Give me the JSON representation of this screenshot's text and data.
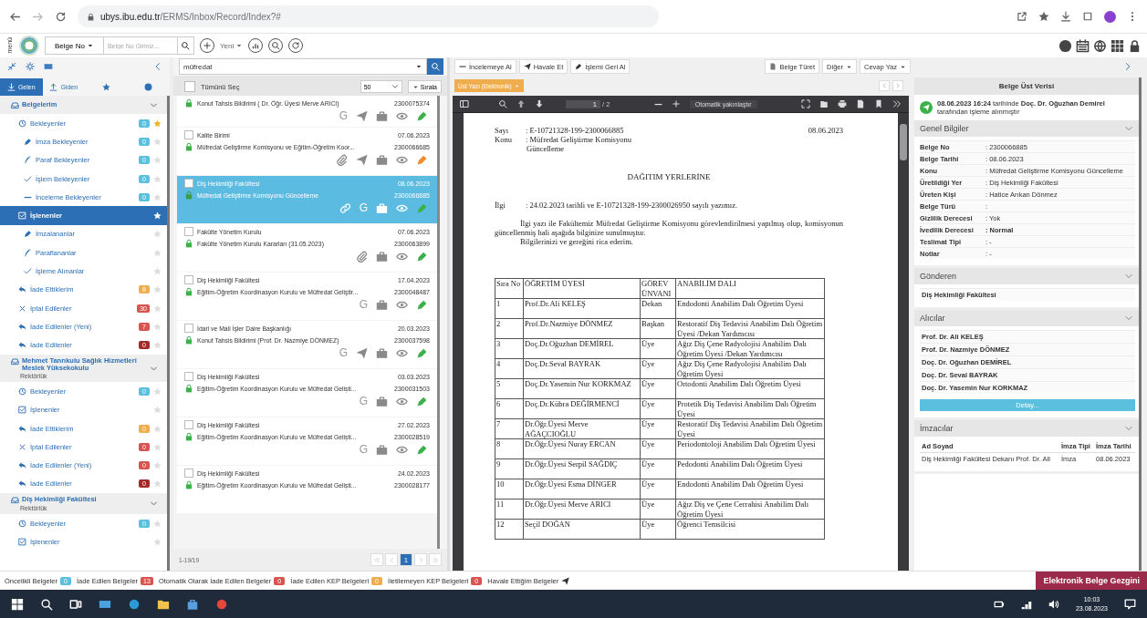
{
  "browser": {
    "host": "ubys.ibu.edu.tr",
    "path": "/ERMS/Inbox/Record/Index?#"
  },
  "toolbar": {
    "menu_label": "menü",
    "search_type": "Belge No",
    "search_placeholder": "Belge No Giriniz...",
    "new_label": "Yeni"
  },
  "sidebar": {
    "tabs": [
      {
        "kind": "incoming",
        "label": "Gelen",
        "selected": true
      },
      {
        "kind": "outgoing",
        "label": "Giden",
        "selected": false
      },
      {
        "kind": "favorites",
        "selected": false
      },
      {
        "kind": "info",
        "selected": false
      }
    ],
    "sections": [
      {
        "title": "Belgelerim",
        "items": [
          {
            "kind": "waiting",
            "label": "Bekleyenler",
            "count": "0",
            "color": "#5bc0de",
            "starred": true,
            "selected": false,
            "children": [
              {
                "kind": "sign",
                "label": "İmza Bekleyenler",
                "count": "0",
                "color": "#5bc0de",
                "starred": false,
                "selected": false
              },
              {
                "kind": "initial",
                "label": "Paraf Bekleyenler",
                "count": "0",
                "color": "#5bc0de",
                "starred": false,
                "selected": false
              },
              {
                "kind": "process",
                "label": "İşlem Bekleyenler",
                "count": "0",
                "color": "#5bc0de",
                "starred": false,
                "selected": false
              },
              {
                "kind": "review",
                "label": "İnceleme Bekleyenler",
                "count": "0",
                "color": "#5bc0de",
                "starred": false,
                "selected": false
              }
            ]
          },
          {
            "kind": "processed",
            "label": "İşlenenler",
            "starred": false,
            "selected": true,
            "children": [
              {
                "kind": "sign",
                "label": "İmzalananlar",
                "starred": false,
                "selected": false
              },
              {
                "kind": "initial",
                "label": "Paraflananlar",
                "starred": false,
                "selected": false
              },
              {
                "kind": "process",
                "label": "İşleme Alınanlar",
                "starred": false,
                "selected": false
              }
            ]
          },
          {
            "kind": "returned",
            "label": "İade Ettiklerim",
            "count": "8",
            "color": "#f0ad4e",
            "starred": false,
            "selected": false
          },
          {
            "kind": "cancelled",
            "label": "İptal Edilenler",
            "count": "30",
            "color": "#d9534f",
            "starred": false,
            "selected": false
          },
          {
            "kind": "returned",
            "label": "İade Edilenler (Yeni)",
            "count": "7",
            "color": "#d9534f",
            "starred": false,
            "selected": false
          },
          {
            "kind": "returned",
            "label": "İade Edilenler",
            "count": "0",
            "color": "#a52a2a",
            "starred": false,
            "selected": false
          }
        ]
      },
      {
        "title": "Mehmet Tanrıkulu Sağlık Hizmetleri Meslek Yüksekokulu",
        "subtitle": "Rektörlük",
        "items": [
          {
            "kind": "waiting",
            "label": "Bekleyenler",
            "count": "0",
            "color": "#5bc0de",
            "starred": false,
            "selected": false
          },
          {
            "kind": "processed",
            "label": "İşlenenler",
            "starred": false,
            "selected": false
          },
          {
            "kind": "returned",
            "label": "İade Ettiklerim",
            "count": "0",
            "color": "#f0ad4e",
            "starred": false,
            "selected": false
          },
          {
            "kind": "cancelled",
            "label": "İptal Edilenler",
            "count": "0",
            "color": "#d9534f",
            "starred": false,
            "selected": false
          },
          {
            "kind": "returned",
            "label": "İade Edilenler (Yeni)",
            "count": "0",
            "color": "#d9534f",
            "starred": false,
            "selected": false
          },
          {
            "kind": "returned",
            "label": "İade Edilenler",
            "count": "0",
            "color": "#a52a2a",
            "starred": false,
            "selected": false
          }
        ]
      },
      {
        "title": "Diş Hekimliği Fakültesi",
        "subtitle": "Rektörlük",
        "items": [
          {
            "kind": "waiting",
            "label": "Bekleyenler",
            "count": "0",
            "color": "#5bc0de",
            "starred": false,
            "selected": false
          },
          {
            "kind": "processed",
            "label": "İşlenenler",
            "starred": false,
            "selected": false
          }
        ]
      }
    ]
  },
  "list": {
    "search_value": "müfredat",
    "select_all": "Tümünü Seç",
    "select_all_checked": false,
    "page_size": "50",
    "sort_label": "Sırala",
    "rows": [
      {
        "subject": "Konut Tahsis Bildirimi ( Dr. Öğr. Üyesi Merve ARICI)",
        "number": "2300075374",
        "selected": false,
        "actions": [
          {
            "kind": "letter",
            "text": "G"
          },
          {
            "kind": "send"
          },
          {
            "kind": "archive"
          },
          {
            "kind": "view"
          },
          {
            "kind": "sign",
            "color": "#3cb04a"
          }
        ]
      },
      {
        "sender": "Kalite Birimi",
        "date": "07.06.2023",
        "subject": "Müfredat Geliştirme Komisyonu ve Eğitim-Öğretim Koor...",
        "number": "2300066685",
        "selected": false,
        "actions": [
          {
            "kind": "attachment"
          },
          {
            "kind": "send"
          },
          {
            "kind": "archive"
          },
          {
            "kind": "view"
          },
          {
            "kind": "sign",
            "color": "#f08c2e"
          }
        ]
      },
      {
        "sender": "Diş Hekimliği Fakültesi",
        "date": "08.06.2023",
        "subject": "Müfredat Geliştirme Komisyonu Güncelleme",
        "number": "2300066885",
        "selected": true,
        "actions": [
          {
            "kind": "link"
          },
          {
            "kind": "letter",
            "text": "G"
          },
          {
            "kind": "archive"
          },
          {
            "kind": "view"
          },
          {
            "kind": "sign",
            "color": "#3cb04a"
          }
        ]
      },
      {
        "sender": "Fakülte Yönetim Kurulu",
        "date": "07.06.2023",
        "subject": "Fakülte Yönetim Kurulu Kararları (31.05.2023)",
        "number": "2300063899",
        "selected": false,
        "actions": [
          {
            "kind": "attachment"
          },
          {
            "kind": "archive"
          },
          {
            "kind": "view"
          },
          {
            "kind": "sign",
            "color": "#3cb04a"
          }
        ]
      },
      {
        "sender": "Diş Hekimliği Fakültesi",
        "date": "17.04.2023",
        "subject": "Eğitim-Öğretim Koordinasyon Kurulu ve Müfredat Geliştir...",
        "number": "2300048487",
        "selected": false,
        "actions": [
          {
            "kind": "letter",
            "text": "G"
          },
          {
            "kind": "archive"
          },
          {
            "kind": "view"
          },
          {
            "kind": "sign",
            "color": "#3cb04a"
          }
        ]
      },
      {
        "sender": "İdari ve Mali İşler Daire Başkanlığı",
        "date": "20.03.2023",
        "subject": "Konut Tahsis Bildirimi (Prof. Dr. Nazmiye DÖNMEZ)",
        "number": "2300037598",
        "selected": false,
        "actions": [
          {
            "kind": "letter",
            "text": "G"
          },
          {
            "kind": "send"
          },
          {
            "kind": "archive"
          },
          {
            "kind": "view"
          },
          {
            "kind": "sign",
            "color": "#3cb04a"
          }
        ]
      },
      {
        "sender": "Diş Hekimliği Fakültesi",
        "date": "03.03.2023",
        "subject": "Eğitim-Öğretim Koordinasyon Kurulu ve Müfredat Geliști...",
        "number": "2300031503",
        "selected": false,
        "actions": [
          {
            "kind": "letter",
            "text": "G"
          },
          {
            "kind": "archive"
          },
          {
            "kind": "view"
          },
          {
            "kind": "sign",
            "color": "#3cb04a"
          }
        ]
      },
      {
        "sender": "Diş Hekimliği Fakültesi",
        "date": "27.02.2023",
        "subject": "Eğitim-Öğretim Koordinasyon Kurulu ve Müfredat Geliști...",
        "number": "2300028519",
        "selected": false,
        "actions": [
          {
            "kind": "letter",
            "text": "G"
          },
          {
            "kind": "archive"
          },
          {
            "kind": "view"
          },
          {
            "kind": "sign",
            "color": "#3cb04a"
          }
        ]
      },
      {
        "sender": "Diş Hekimliği Fakültesi",
        "date": "24.02.2023",
        "subject": "Eğitim-Öğretim Koordinasyon Kurulu ve Müfredat Geliști...",
        "number": "2300028177",
        "selected": false,
        "actions": []
      }
    ],
    "range": "1-19/19",
    "current_page": "1"
  },
  "actions": {
    "left": [
      "İncelemeye Al",
      "Havale Et",
      "İşlemi Geri Al"
    ],
    "right": [
      {
        "kind": "derive",
        "label": "Belge Türet"
      },
      {
        "kind": "menu",
        "label": "Diğer"
      },
      {
        "kind": "menu",
        "label": "Cevap Yaz"
      }
    ]
  },
  "viewer": {
    "attachment_label": "Üst Yazı (Elektronik)",
    "page": "1",
    "page_total": "/ 2",
    "zoom": "Otomatik yakınlaştır",
    "document": {
      "number_label": "Sayı",
      "number": ": E-10721328-199-2300066885",
      "date": "08.06.2023",
      "subject_label": "Konu",
      "subject": ": Müfredat Geliştirme Komisyonu",
      "subject_cont": "Güncelleme",
      "heading": "DAĞITIM YERLERİNE",
      "ref_label": "İlgi",
      "ref": ": 24.02.2023 tarihli ve E-10721328-199-2300026950 sayılı yazımız.",
      "body": "İlgi yazı ile Fakültemiz Müfredat Geliştirme Komisyonu görevlendirilmesi yapılmış olup, komisyonun güncellenmiş hali aşağıda bilginize sunulmuştur.",
      "closing": "Bilgilerinizi ve gereğini rica ederim.",
      "columns": [
        "Sıra No",
        "ÖĞRETİM ÜYESİ",
        "GÖREV ÜNVANI",
        "ANABİLİM DALI"
      ],
      "rows": [
        [
          "1",
          "Prof.Dr.Ali KELEŞ",
          "Dekan",
          "Endodonti Anabilim Dalı Öğretim Üyesi"
        ],
        [
          "2",
          "Prof.Dr.Nazmiye DÖNMEZ",
          "Başkan",
          "Restoratif Diş Tedavisi Anabilim Dalı Öğretim Üyesi /Dekan Yardımcısı"
        ],
        [
          "3",
          "Doç.Dr.Oğuzhan DEMİREL",
          "Üye",
          "Ağız Diş Çene Radyolojisi Anabilim Dalı Öğretim Üyesi /Dekan Yardımcısı"
        ],
        [
          "4",
          "Doç.Dr.Seval BAYRAK",
          "Üye",
          "Ağız Diş Çene Radyolojisi Anabilim Dalı Öğretim Üyesi"
        ],
        [
          "5",
          "Doç.Dr.Yasemin Nur KORKMAZ",
          "Üye",
          "Ortodonti Anabilim Dalı Öğretim Üyesi"
        ],
        [
          "6",
          "Doç.Dr.Kübra DEĞİRMENCİ",
          "Üye",
          "Protetik Diş Tedavisi Anabilim Dalı Öğretim Üyesi"
        ],
        [
          "7",
          "Dr.Öğr.Üyesi Merve AĞAÇCIOĞLU",
          "Üye",
          "Restoratif Diş Tedavisi Anabilim Dalı Öğretim Üyesi"
        ],
        [
          "8",
          "Dr.Öğr.Üyesi Nuray ERCAN",
          "Üye",
          "Periodontoloji Anabilim Dalı Öğretim Üyesi"
        ],
        [
          "9",
          "Dr.Öğr.Üyesi Serpil SAĞDIÇ",
          "Üye",
          "Pedodonti Anabilim Dalı Öğretim Üyesi"
        ],
        [
          "10",
          "Dr.Öğr.Üyesi Esma DİNGER",
          "Üye",
          "Endodonti Anabilim Dalı Öğretim Üyesi"
        ],
        [
          "11",
          "Dr.Öğr.Üyesi Merve ARICI",
          "Üye",
          "Ağız Diş ve Çene Cerrahisi Anabilim Dalı Öğretim Üyesi"
        ],
        [
          "12",
          "Seçil DOĞAN",
          "Üye",
          "Öğrenci Temsilcisi"
        ]
      ]
    }
  },
  "metadata": {
    "title": "Belge Üst Verisi",
    "notice": "**08.06.2023 16:24** tarihinde **Doç. Dr. Oğuzhan Demirel** tarafından işleme alınmıştır",
    "general": {
      "title": "Genel Bilgiler",
      "fields": [
        {
          "label": "Belge No",
          "value": ": 2300066885",
          "bold": false
        },
        {
          "label": "Belge Tarihi",
          "value": ": 08.06.2023",
          "bold": false
        },
        {
          "label": "Konu",
          "value": ": Müfredat Geliştirme Komisyonu Güncelleme",
          "bold": false
        },
        {
          "label": "Üretildiği Yer",
          "value": ": Diş Hekimliği Fakültesi",
          "bold": false
        },
        {
          "label": "Üreten Kişi",
          "value": ": Hatice Arıkan Dönmez",
          "bold": false
        },
        {
          "label": "Belge Türü",
          "value": ":",
          "bold": false
        },
        {
          "label": "Gizlilik Derecesi",
          "value": ": Yok",
          "bold": false
        },
        {
          "label": "İvedilik Derecesi",
          "value": ": Normal",
          "bold": true
        },
        {
          "label": "Teslimat Tipi",
          "value": ": -",
          "bold": false
        },
        {
          "label": "Notlar",
          "value": ": -",
          "bold": false
        }
      ]
    },
    "sender": {
      "title": "Gönderen",
      "items": [
        "Diş Hekimliği Fakültesi"
      ]
    },
    "recipients": {
      "title": "Alıcılar",
      "items": [
        "Prof. Dr. Ali KELEŞ",
        "Prof. Dr. Nazmiye DÖNMEZ",
        "Doç. Dr. Oğuzhan DEMİREL",
        "Doç. Dr. Seval BAYRAK",
        "Doç. Dr. Yasemin Nur KORKMAZ"
      ],
      "button": "Detay..."
    },
    "signers": {
      "title": "İmzacılar",
      "columns": [
        "Ad Soyad",
        "İmza Tipi",
        "İmza Tarihi"
      ],
      "rows": [
        [
          "Diş Hekimliği Fakültesi Dekanı Prof. Dr. Ali",
          "İmza",
          "08.06.2023"
        ]
      ]
    }
  },
  "status_bar": {
    "items": [
      {
        "label": "Öncelikli Belgeler",
        "count": "0",
        "color": "#5bc0de"
      },
      {
        "label": "İade Edilen Belgeler",
        "count": "13",
        "color": "#d9534f"
      },
      {
        "label": "Otomatik Olarak İade Edilen Belgeler",
        "count": "0",
        "color": "#d9534f"
      },
      {
        "label": "İade Edilen KEP Belgeleri",
        "count": "0",
        "color": "#f0ad4e"
      },
      {
        "label": "İletilemeyen KEP Belgeleri",
        "count": "0",
        "color": "#d9534f"
      },
      {
        "label": "Havale Ettiğim Belgeler",
        "icon": true
      }
    ],
    "explorer": "Elektronik Belge Gezgini"
  },
  "taskbar": {
    "time": "10:03",
    "date": "23.08.2023"
  }
}
